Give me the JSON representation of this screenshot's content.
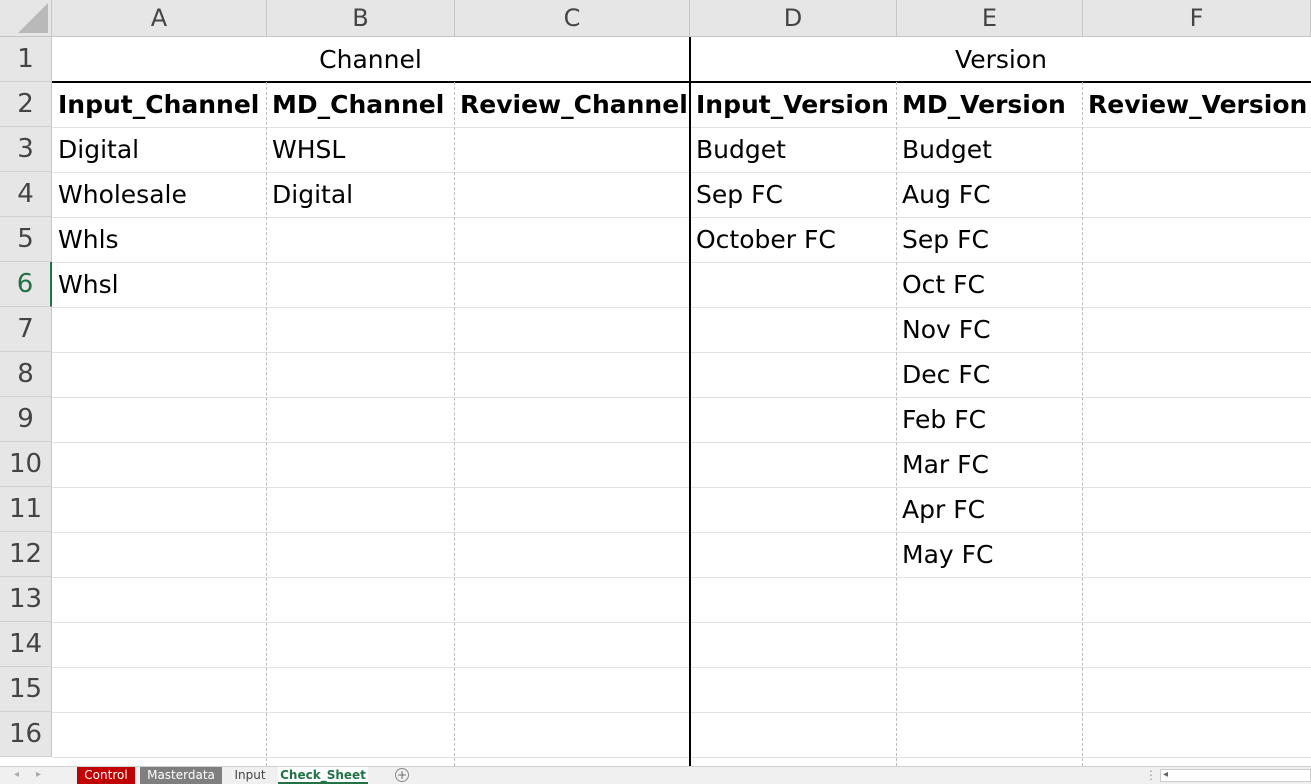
{
  "columns": [
    "A",
    "B",
    "C",
    "D",
    "E",
    "F"
  ],
  "rows": [
    "1",
    "2",
    "3",
    "4",
    "5",
    "6",
    "7",
    "8",
    "9",
    "10",
    "11",
    "12",
    "13",
    "14",
    "15",
    "16"
  ],
  "active_row": "6",
  "headers": {
    "channel_group": "Channel",
    "version_group": "Version",
    "input_channel": "Input_Channel",
    "md_channel": "MD_Channel",
    "review_channel": "Review_Channel",
    "input_version": "Input_Version",
    "md_version": "MD_Version",
    "review_version": "Review_Version"
  },
  "input_channel": [
    "Digital",
    "Wholesale",
    "Whls",
    "Whsl"
  ],
  "md_channel": [
    "WHSL",
    "Digital"
  ],
  "input_version": [
    "Budget",
    "Sep FC",
    "October FC"
  ],
  "md_version": [
    "Budget",
    "Aug FC",
    "Sep FC",
    "Oct FC",
    "Nov FC",
    "Dec FC",
    "Feb FC",
    "Mar FC",
    "Apr FC",
    "May FC"
  ],
  "sheet_tabs": [
    {
      "label": "Control",
      "color": "#c00000"
    },
    {
      "label": "Masterdata",
      "color": "#7f7f7f"
    },
    {
      "label": "Input",
      "color": "#f0f0f0"
    },
    {
      "label": "Check_Sheet",
      "color": "#ffffff"
    }
  ],
  "active_tab": "Check_Sheet",
  "add_sheet_symbol": "+",
  "colors": {
    "accent": "#217346",
    "control_tab": "#c00000",
    "masterdata_tab": "#7f7f7f"
  }
}
